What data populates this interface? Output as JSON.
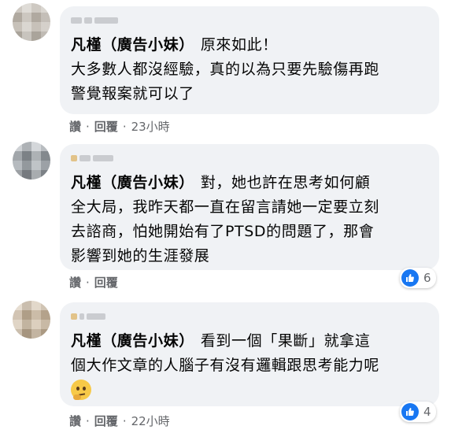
{
  "comments": [
    {
      "author": "凡槿（廣告小妹）",
      "text": "原來如此！大多數人都沒經驗，真的以為只要先驗傷再跑警覺報案就可以了",
      "lines": [
        "凡槿（廣告小妹） 原來如此！",
        "大多數人都沒經驗，真的以為只要先驗傷再跑",
        "警覺報案就可以了"
      ],
      "like_label": "讚",
      "reply_label": "回覆",
      "time": "23小時",
      "reaction_count": ""
    },
    {
      "author": "凡槿（廣告小妹）",
      "lines": [
        "凡槿（廣告小妹） 對，她也許在思考如何顧",
        "全大局，我昨天都一直在留言請她一定要立刻",
        "去諮商，怕她開始有了PTSD的問題了，那會",
        "影響到她的生涯發展"
      ],
      "like_label": "讚",
      "reply_label": "回覆",
      "time": "",
      "reaction_count": "6"
    },
    {
      "author": "凡槿（廣告小妹）",
      "lines": [
        "凡槿（廣告小妹） 看到一個「果斷」就拿這",
        "個大作文章的人腦子有沒有邏輯跟思考能力呢"
      ],
      "like_label": "讚",
      "reply_label": "回覆",
      "time": "22小時",
      "reaction_count": "4",
      "emoji": "thinking-face"
    }
  ],
  "colors": {
    "bubble": "#f0f2f5",
    "secondary_text": "#65676b",
    "like_blue": "#1877f2"
  }
}
